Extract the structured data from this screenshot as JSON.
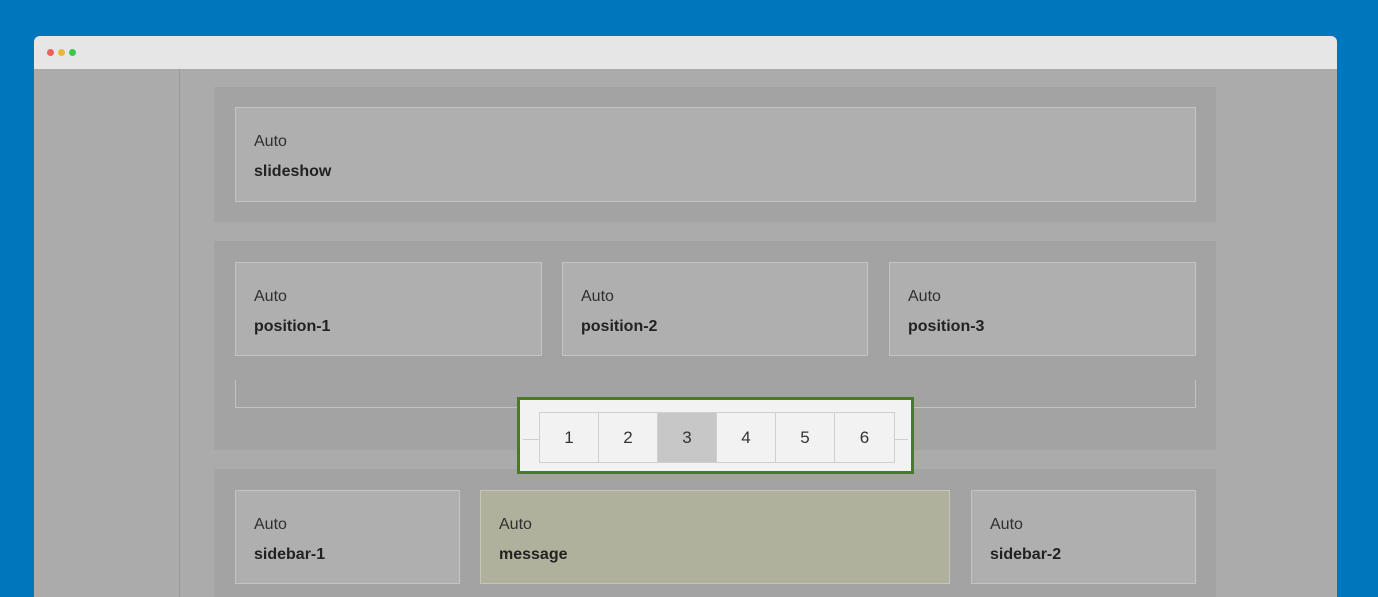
{
  "window": {
    "controls": [
      "close",
      "minimize",
      "maximize"
    ]
  },
  "rows": [
    {
      "blocks": [
        {
          "label": "Auto",
          "name": "slideshow"
        }
      ]
    },
    {
      "blocks": [
        {
          "label": "Auto",
          "name": "position-1"
        },
        {
          "label": "Auto",
          "name": "position-2"
        },
        {
          "label": "Auto",
          "name": "position-3"
        }
      ]
    },
    {
      "blocks": [
        {
          "label": "Auto",
          "name": "sidebar-1"
        },
        {
          "label": "Auto",
          "name": "message",
          "highlighted": true
        },
        {
          "label": "Auto",
          "name": "sidebar-2"
        }
      ]
    }
  ],
  "pagination": {
    "pages": [
      "1",
      "2",
      "3",
      "4",
      "5",
      "6"
    ],
    "active_page": "3"
  },
  "colors": {
    "background": "#0077bd",
    "highlight_block": "#b0b19c",
    "selection_border": "#4a7a25"
  }
}
